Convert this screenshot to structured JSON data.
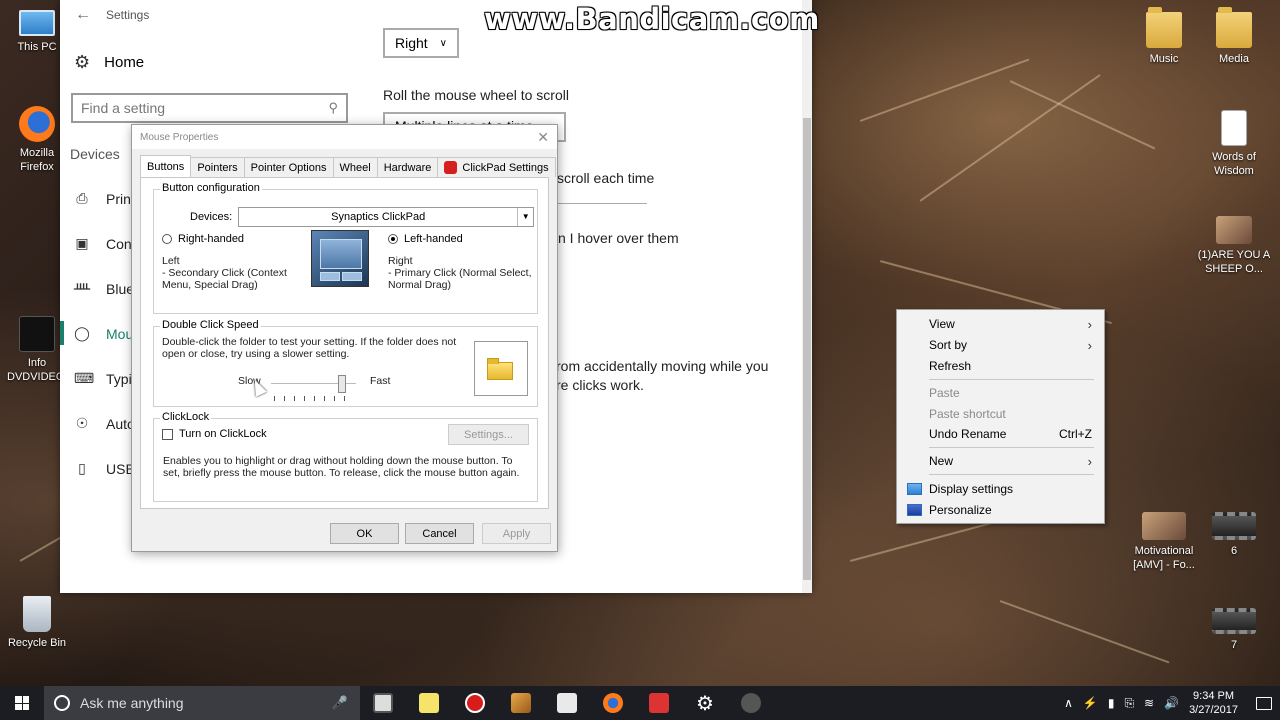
{
  "watermark": "www.Bandicam.com",
  "desktop": {
    "icons_left": [
      {
        "label": "This PC",
        "icon": "pc-icon"
      },
      {
        "label": "Mozilla Firefox",
        "icon": "firefox-icon"
      },
      {
        "label": "Info DVDVIDEOS",
        "icon": "video-file-icon"
      },
      {
        "label": "Recycle Bin",
        "icon": "recycle-bin-icon"
      }
    ],
    "icons_right": [
      {
        "label": "Music",
        "icon": "folder-icon"
      },
      {
        "label": "Media",
        "icon": "folder-icon"
      },
      {
        "label": "Words of Wisdom",
        "icon": "document-icon"
      },
      {
        "label": "(1)ARE YOU A SHEEP O...",
        "icon": "video-file-icon"
      },
      {
        "label": "Motivational [AMV] - Fo...",
        "icon": "video-file-icon"
      },
      {
        "label": "6",
        "icon": "video-file-icon"
      },
      {
        "label": "7",
        "icon": "video-file-icon"
      }
    ]
  },
  "settings": {
    "title": "Settings",
    "home": "Home",
    "search_placeholder": "Find a setting",
    "section": "Devices",
    "nav": [
      "Print",
      "Conn",
      "Blueto",
      "Mous",
      "Typin",
      "Auto",
      "USB"
    ],
    "primary_button_value": "Right",
    "scroll_heading": "Roll the mouse wheel to scroll",
    "scroll_value": "Multiple lines at a time",
    "partial_scroll": "scroll each time",
    "partial_hover": "n I hover over them",
    "partial_prevent_1": "rom accidentally moving while you",
    "partial_prevent_2": "re clicks work."
  },
  "dialog": {
    "title": "Mouse Properties",
    "tabs": [
      "Buttons",
      "Pointers",
      "Pointer Options",
      "Wheel",
      "Hardware",
      "ClickPad Settings"
    ],
    "button_config": {
      "label": "Button configuration",
      "devices_label": "Devices:",
      "device_value": "Synaptics ClickPad",
      "right_handed": "Right-handed",
      "left_handed": "Left-handed",
      "left_desc_title": "Left",
      "left_desc": "- Secondary Click (Context Menu, Special Drag)",
      "right_desc_title": "Right",
      "right_desc": "- Primary Click (Normal Select, Normal Drag)"
    },
    "double_click": {
      "label": "Double Click Speed",
      "desc": "Double-click the folder to test your setting.  If the folder does not open or close, try using a slower setting.",
      "slow": "Slow",
      "fast": "Fast",
      "speed_level": 0.8
    },
    "clicklock": {
      "label": "ClickLock",
      "checkbox": "Turn on ClickLock",
      "settings_btn": "Settings...",
      "desc": "Enables you to highlight or drag without holding down the mouse button.  To set, briefly press the mouse button.  To release, click the mouse button again."
    },
    "ok": "OK",
    "cancel": "Cancel",
    "apply": "Apply"
  },
  "context_menu": {
    "view": "View",
    "sort_by": "Sort by",
    "refresh": "Refresh",
    "paste": "Paste",
    "paste_shortcut": "Paste shortcut",
    "undo_rename": "Undo Rename",
    "undo_shortcut": "Ctrl+Z",
    "new": "New",
    "display_settings": "Display settings",
    "personalize": "Personalize"
  },
  "taskbar": {
    "search_placeholder": "Ask me anything",
    "time": "9:34 PM",
    "date": "3/27/2017"
  }
}
